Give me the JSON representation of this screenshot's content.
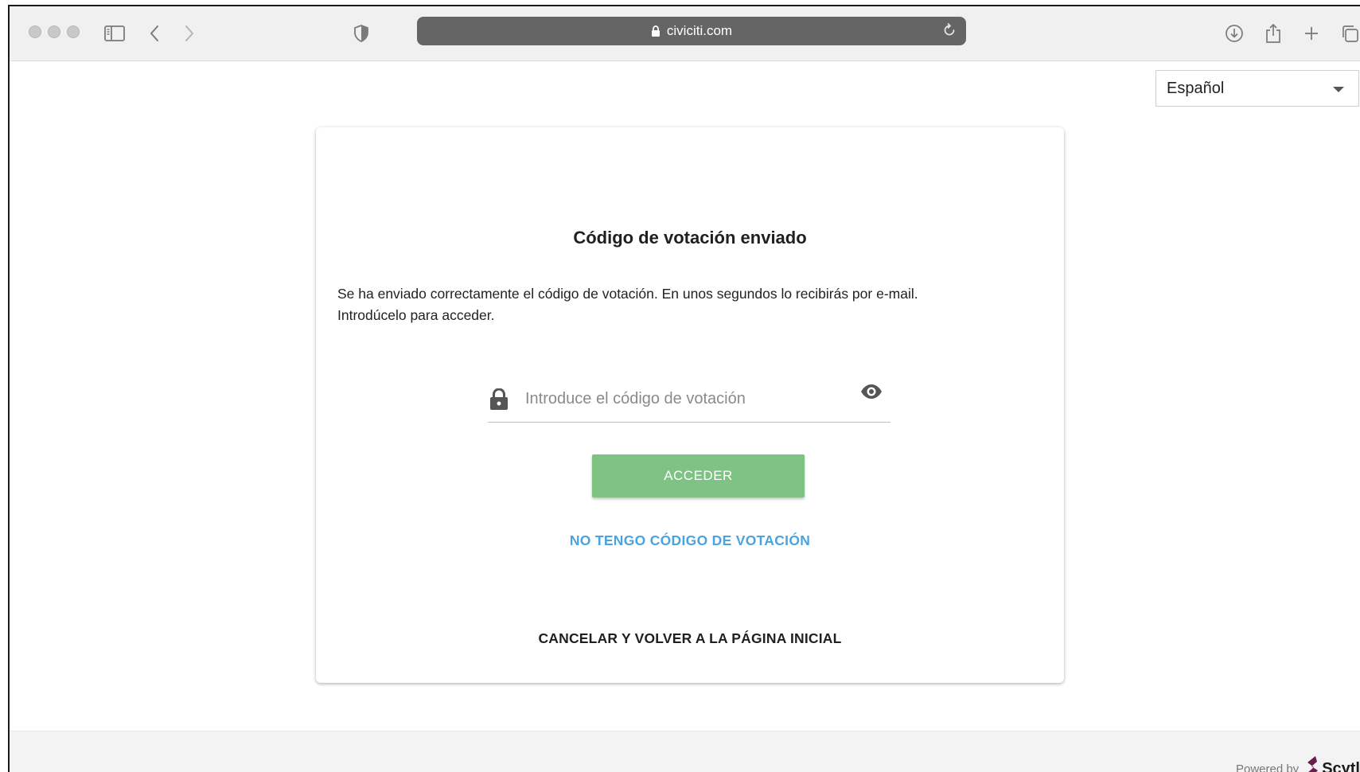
{
  "browser": {
    "url": "civiciti.com",
    "icons": {
      "sidebar": "sidebar-icon",
      "back": "chevron-left-icon",
      "forward": "chevron-right-icon",
      "shield": "shield-icon",
      "lock": "lock-icon",
      "reload": "reload-icon",
      "download": "download-icon",
      "share": "share-icon",
      "new_tab": "plus-icon",
      "tabs": "tabs-icon"
    }
  },
  "language": {
    "selected": "Español"
  },
  "card": {
    "title": "Código de votación enviado",
    "message_line1": "Se ha enviado correctamente el código de votación. En unos segundos lo recibirás por e-mail.",
    "message_line2": "Introdúcelo para acceder.",
    "code_input": {
      "placeholder": "Introduce el código de votación",
      "value": ""
    },
    "access_button": "ACCEDER",
    "no_code_link": "NO TENGO CÓDIGO DE VOTACIÓN",
    "cancel_link": "CANCELAR Y VOLVER A LA PÁGINA INICIAL"
  },
  "footer": {
    "powered_by": "Powered by",
    "brand": "Scytl"
  },
  "colors": {
    "accent_green": "#7ec284",
    "link_blue": "#4aa3df",
    "url_bar": "#656565",
    "brand_purple": "#6b1d4f"
  }
}
